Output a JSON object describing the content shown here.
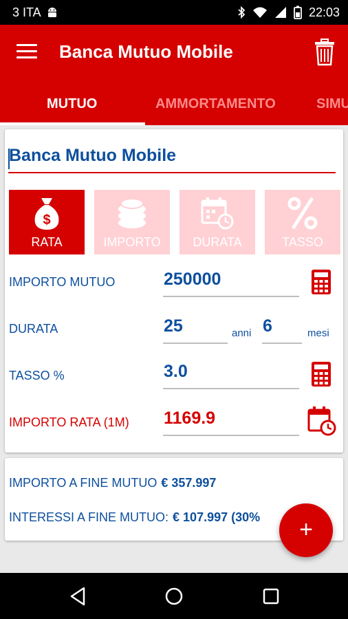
{
  "status_bar": {
    "carrier": "3 ITA",
    "time": "22:03",
    "icons": [
      "android-debug-icon",
      "bluetooth-icon",
      "wifi-icon",
      "signal-icon",
      "battery-icon"
    ]
  },
  "app_bar": {
    "title": "Banca Mutuo Mobile",
    "menu_icon": "menu-icon",
    "trash_icon": "trash-icon"
  },
  "tabs": [
    {
      "label": "MUTUO",
      "active": true
    },
    {
      "label": "AMMORTAMENTO",
      "active": false
    },
    {
      "label": "SIMU",
      "active": false
    }
  ],
  "form": {
    "name_value": "Banca Mutuo Mobile",
    "modes": [
      {
        "label": "RATA",
        "icon": "money-bag-icon",
        "selected": true
      },
      {
        "label": "IMPORTO",
        "icon": "coins-icon",
        "selected": false
      },
      {
        "label": "DURATA",
        "icon": "calendar-clock-icon",
        "selected": false
      },
      {
        "label": "TASSO",
        "icon": "percent-icon",
        "selected": false
      }
    ],
    "importo_label": "IMPORTO MUTUO",
    "importo_value": "250000",
    "durata_label": "DURATA",
    "durata_anni_value": "25",
    "anni_unit": "anni",
    "durata_mesi_value": "6",
    "mesi_unit": "mesi",
    "tasso_label": "TASSO %",
    "tasso_value": "3.0",
    "rata_label": "IMPORTO RATA (1M)",
    "rata_value": "1169.9"
  },
  "summary": {
    "fine_label": "IMPORTO A FINE MUTUO",
    "fine_value": "€ 357.997",
    "interessi_label": "INTERESSI A FINE MUTUO:",
    "interessi_value": "€ 107.997 (30%"
  },
  "fab": {
    "label": "+"
  },
  "colors": {
    "primary": "#d50000",
    "text_blue": "#0d4f9e",
    "mode_unselected": "#ffd0d4"
  }
}
